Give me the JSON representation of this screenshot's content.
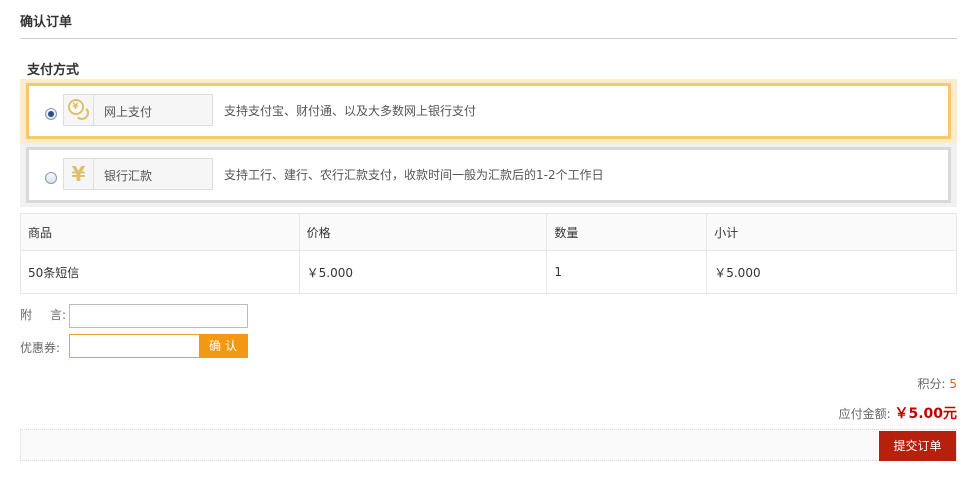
{
  "page": {
    "title": "确认订单"
  },
  "payment": {
    "section_title": "支付方式",
    "options": [
      {
        "label": "网上支付",
        "desc": "支持支付宝、财付通、以及大多数网上银行支付",
        "selected": true,
        "icon": "coin-icon",
        "accent": "#f5c96c"
      },
      {
        "label": "银行汇款",
        "desc": "支持工行、建行、农行汇款支付，收款时间一般为汇款后的1-2个工作日",
        "selected": false,
        "icon": "yen-icon",
        "accent": "#d9d9d9"
      }
    ]
  },
  "table": {
    "headers": [
      "商品",
      "价格",
      "数量",
      "小计"
    ],
    "rows": [
      [
        "50条短信",
        "￥5.000",
        "1",
        "￥5.000"
      ]
    ]
  },
  "form": {
    "memo_label_1": "附",
    "memo_label_2": "言:",
    "memo_value": "",
    "coupon_label": "优惠券:",
    "coupon_value": "",
    "confirm_label": "确认"
  },
  "summary": {
    "points_label": "积分:",
    "points_value": "5",
    "total_label": "应付金额:",
    "total_value": "￥5.00元"
  },
  "submit": {
    "label": "提交订单",
    "color": "#b8200e"
  },
  "colors": {
    "accent_orange": "#f39813",
    "price_red": "#c40000"
  }
}
